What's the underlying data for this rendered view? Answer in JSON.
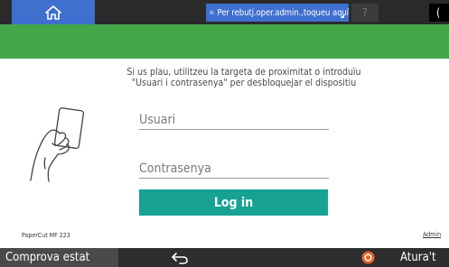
{
  "topbar": {
    "home_icon": "home-icon",
    "notice_icon": "operator-screen-icon",
    "notice_text": "Per rebutj.oper.admin.,toqueu aquí",
    "help_label": "?",
    "right_label": "("
  },
  "login": {
    "instructions_line1": "Si us plau, utilitzeu la targeta de proximitat o introduïu",
    "instructions_line2": "\"Usuari i contrasenya\" per desbloquejar el dispositiu",
    "card_icon": "hand-card-icon",
    "username_placeholder": "Usuari",
    "password_placeholder": "Contrasenya",
    "login_label": "Log in"
  },
  "footer": {
    "product": "PaperCut MF 223",
    "admin_link": "Admin"
  },
  "bottombar": {
    "status_label": "Comprova estat",
    "back_icon": "back-arrow-icon",
    "stop_icon": "stop-icon",
    "stop_label": "Atura't"
  },
  "colors": {
    "accent_blue": "#3f6fcf",
    "banner_green": "#43a74a",
    "login_teal": "#17a294",
    "bar_dark": "#2a2a2a",
    "stop_orange": "#e8632b"
  }
}
